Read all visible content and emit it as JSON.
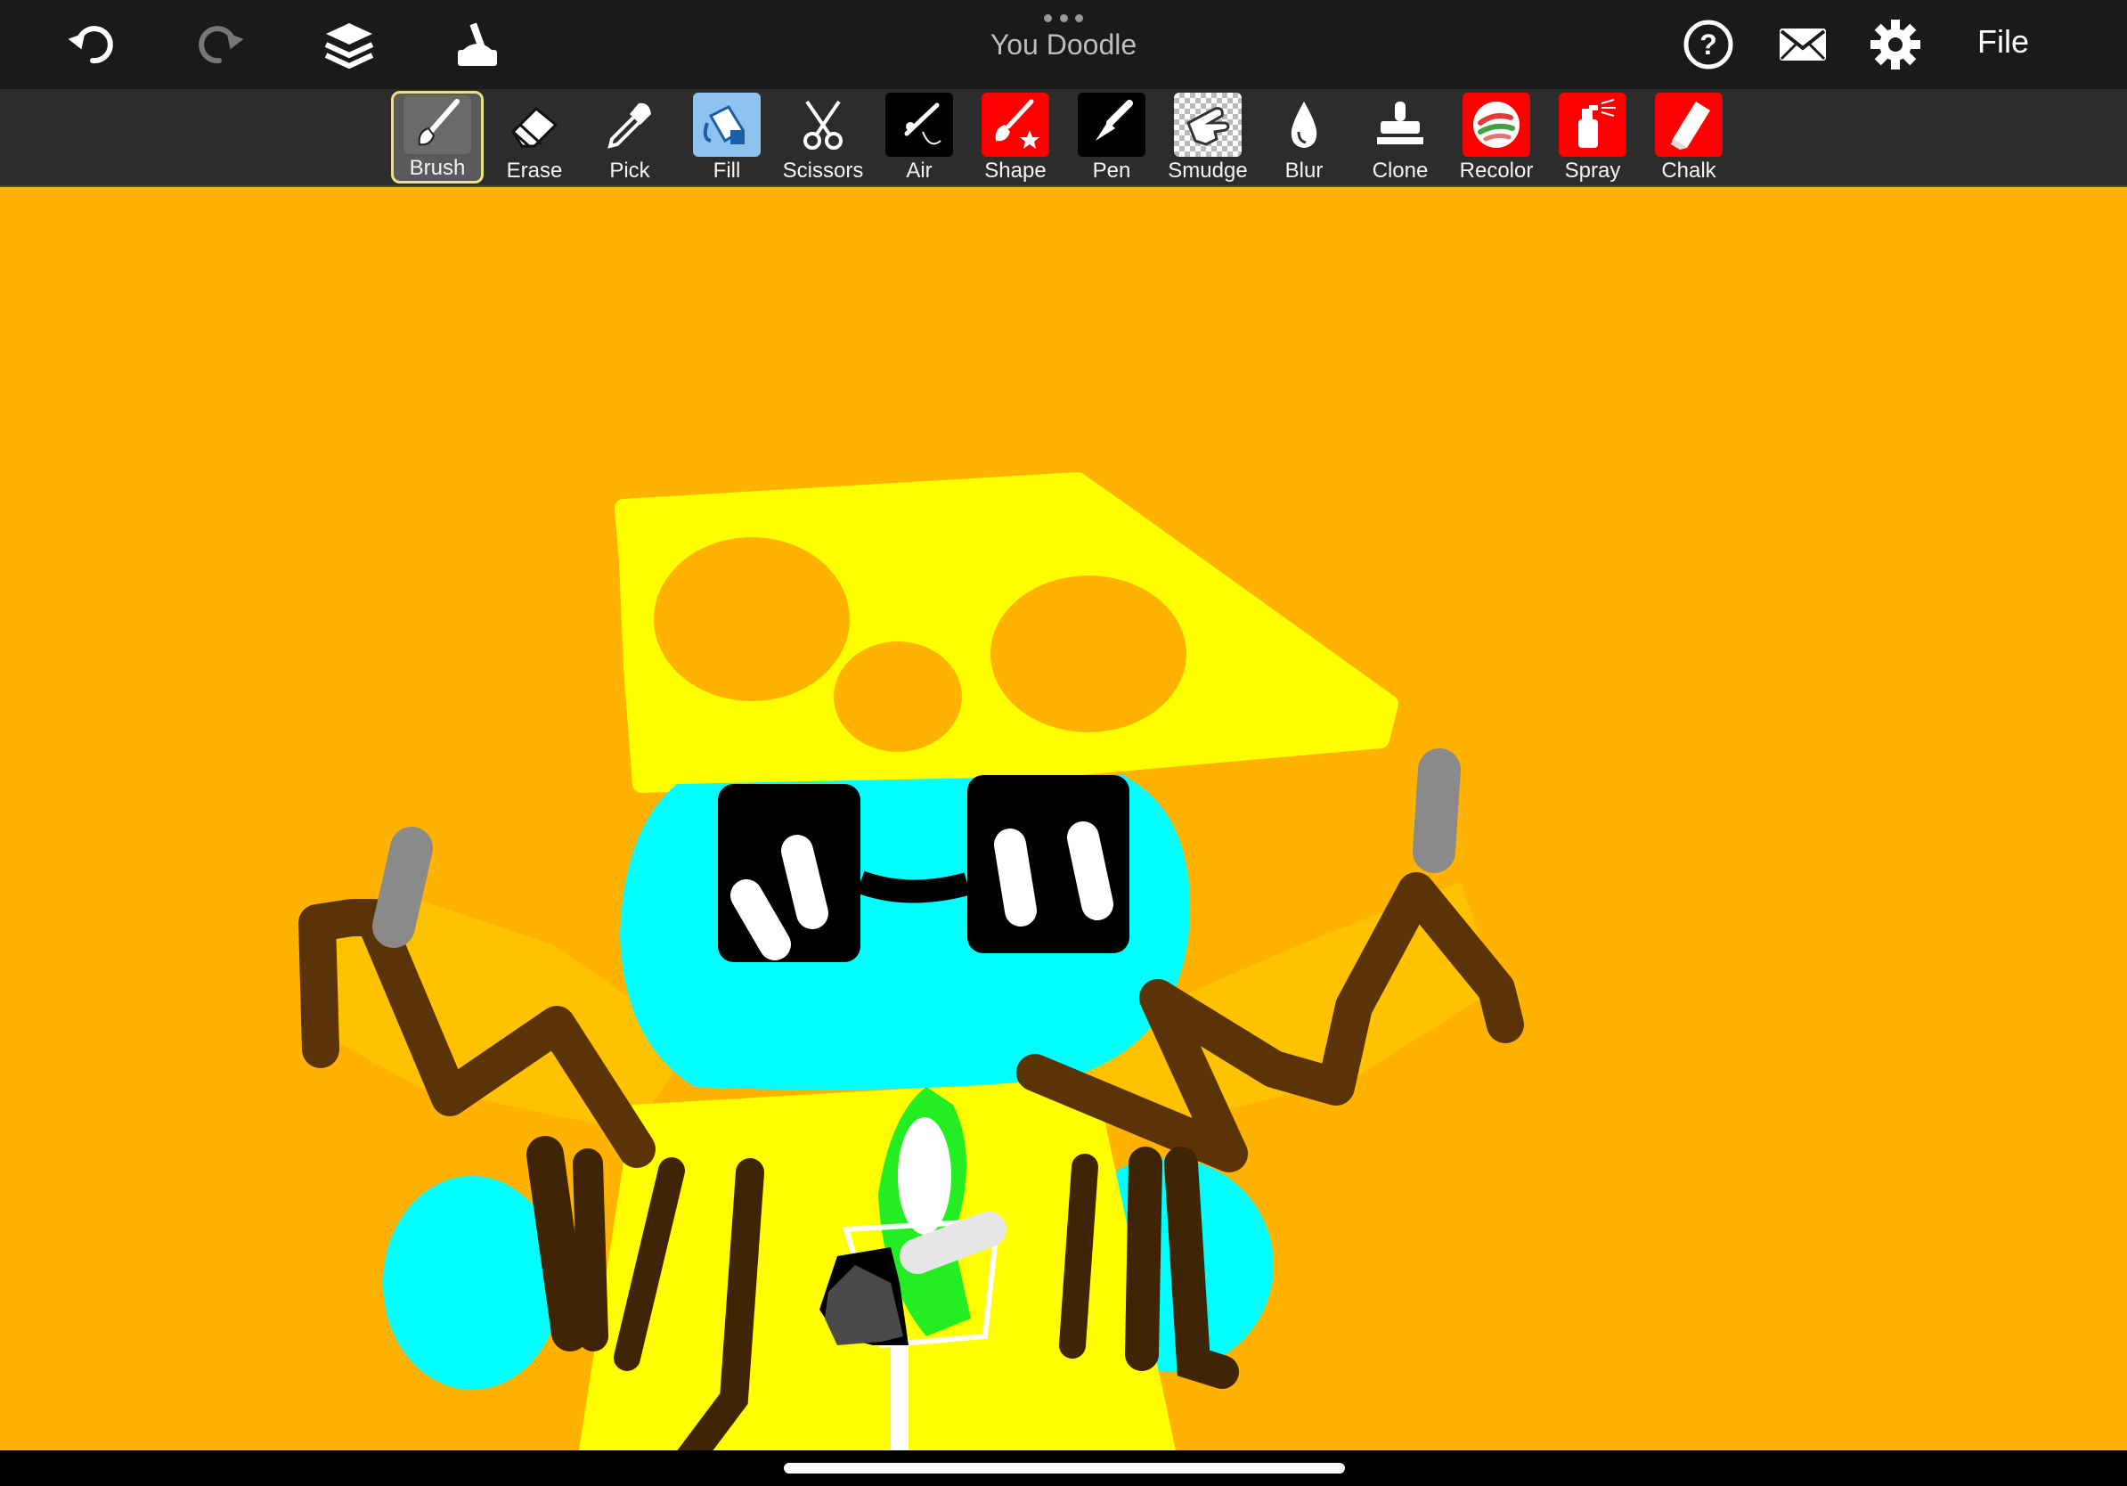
{
  "app": {
    "title": "You Doodle",
    "file_label": "File"
  },
  "topbar": {
    "icons": [
      "undo-icon",
      "redo-icon",
      "layers-icon",
      "tools-icon",
      "help-icon",
      "mail-icon",
      "settings-icon"
    ]
  },
  "toolbar": {
    "selected": "Brush",
    "tools": [
      {
        "label": "Brush",
        "icon": "brush-icon",
        "bg": "#6a6a6a"
      },
      {
        "label": "Erase",
        "icon": "eraser-icon",
        "bg": "transparent"
      },
      {
        "label": "Pick",
        "icon": "eyedropper-icon",
        "bg": "transparent"
      },
      {
        "label": "Fill",
        "icon": "fill-bucket-icon",
        "bg": "#8fc3ef"
      },
      {
        "label": "Scissors",
        "icon": "scissors-icon",
        "bg": "transparent"
      },
      {
        "label": "Air",
        "icon": "airbrush-icon",
        "bg": "#000000"
      },
      {
        "label": "Shape",
        "icon": "shape-brush-icon",
        "bg": "#ff0000"
      },
      {
        "label": "Pen",
        "icon": "pen-icon",
        "bg": "#000000"
      },
      {
        "label": "Smudge",
        "icon": "smudge-icon",
        "bg": "checker"
      },
      {
        "label": "Blur",
        "icon": "blur-drop-icon",
        "bg": "transparent"
      },
      {
        "label": "Clone",
        "icon": "clone-stamp-icon",
        "bg": "transparent"
      },
      {
        "label": "Recolor",
        "icon": "recolor-icon",
        "bg": "#ff0000"
      },
      {
        "label": "Spray",
        "icon": "spray-can-icon",
        "bg": "#ff0000"
      },
      {
        "label": "Chalk",
        "icon": "chalk-icon",
        "bg": "#ff0000"
      }
    ]
  },
  "canvas": {
    "background": "#ffb200"
  },
  "colors": {
    "yellow": "#ffff00",
    "cyan": "#00ffff",
    "brown": "#5a3408",
    "gray": "#8a8a8a",
    "green": "#22ee22",
    "black": "#000000",
    "white": "#ffffff"
  }
}
